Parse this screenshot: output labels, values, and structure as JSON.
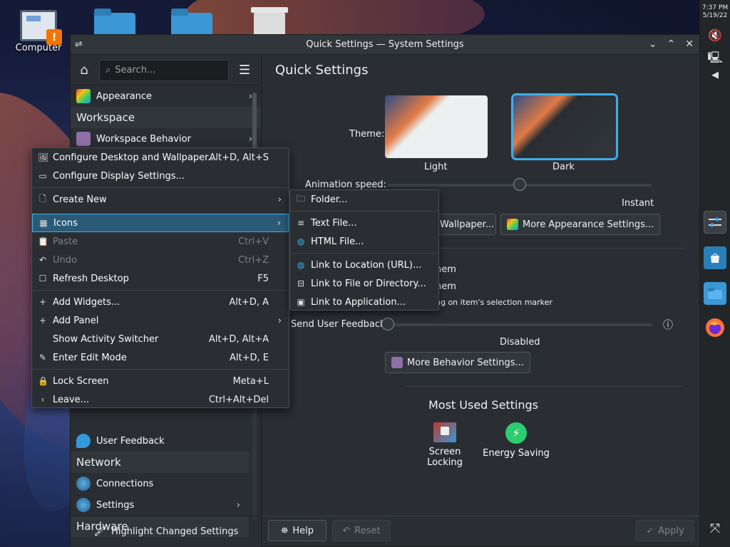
{
  "desktop": {
    "computer_label": "Computer",
    "warning_mark": "!"
  },
  "panel": {
    "time": "7:37 PM",
    "date": "5/19/22"
  },
  "window": {
    "title": "Quick Settings — System Settings"
  },
  "sidebar": {
    "search_placeholder": "Search...",
    "items": [
      {
        "label": "Appearance"
      },
      {
        "category": "Workspace"
      },
      {
        "label": "Workspace Behavior"
      },
      {
        "label": "User Feedback"
      },
      {
        "category": "Network"
      },
      {
        "label": "Connections"
      },
      {
        "label": "Settings"
      },
      {
        "category": "Hardware"
      }
    ],
    "highlight_label": "Highlight Changed Settings"
  },
  "content": {
    "title": "Quick Settings",
    "theme_label": "Theme:",
    "theme_light": "Light",
    "theme_dark": "Dark",
    "animation_label": "Animation speed:",
    "animation_value": "Instant",
    "animation_level": 0.5,
    "wallpaper_button": "Wallpaper...",
    "more_appearance_button": "More Appearance Settings...",
    "click_text_1": "hem",
    "click_text_2": "hem",
    "click_text_3": "ng on item's selection marker",
    "feedback_label": "Send User Feedback:",
    "feedback_value": "Disabled",
    "feedback_level": 0,
    "more_behavior_button": "More Behavior Settings...",
    "most_used_title": "Most Used Settings",
    "most_used": [
      {
        "label_1": "Screen",
        "label_2": "Locking"
      },
      {
        "label_1": "Energy Saving"
      }
    ],
    "help_button": "Help",
    "reset_button": "Reset",
    "apply_button": "Apply"
  },
  "context_menu": {
    "items": [
      {
        "label": "Configure Desktop and Wallpaper...",
        "shortcut": "Alt+D, Alt+S"
      },
      {
        "label": "Configure Display Settings...",
        "shortcut": ""
      },
      {
        "label": "Create New",
        "shortcut": ""
      },
      {
        "label": "Icons",
        "shortcut": ""
      },
      {
        "label": "Paste",
        "shortcut": "Ctrl+V"
      },
      {
        "label": "Undo",
        "shortcut": "Ctrl+Z"
      },
      {
        "label": "Refresh Desktop",
        "shortcut": "F5"
      },
      {
        "label": "Add Widgets...",
        "shortcut": "Alt+D, A"
      },
      {
        "label": "Add Panel",
        "shortcut": ""
      },
      {
        "label": "Show Activity Switcher",
        "shortcut": "Alt+D, Alt+A"
      },
      {
        "label": "Enter Edit Mode",
        "shortcut": "Alt+D, E"
      },
      {
        "label": "Lock Screen",
        "shortcut": "Meta+L"
      },
      {
        "label": "Leave...",
        "shortcut": "Ctrl+Alt+Del"
      }
    ]
  },
  "submenu": {
    "items": [
      {
        "label": "Folder..."
      },
      {
        "label": "Text File..."
      },
      {
        "label": "HTML File..."
      },
      {
        "label": "Link to Location (URL)..."
      },
      {
        "label": "Link to File or Directory..."
      },
      {
        "label": "Link to Application..."
      }
    ]
  },
  "colors": {
    "accent": "#3daee9",
    "window_bg": "#2a2e32",
    "warning": "#f67400"
  }
}
